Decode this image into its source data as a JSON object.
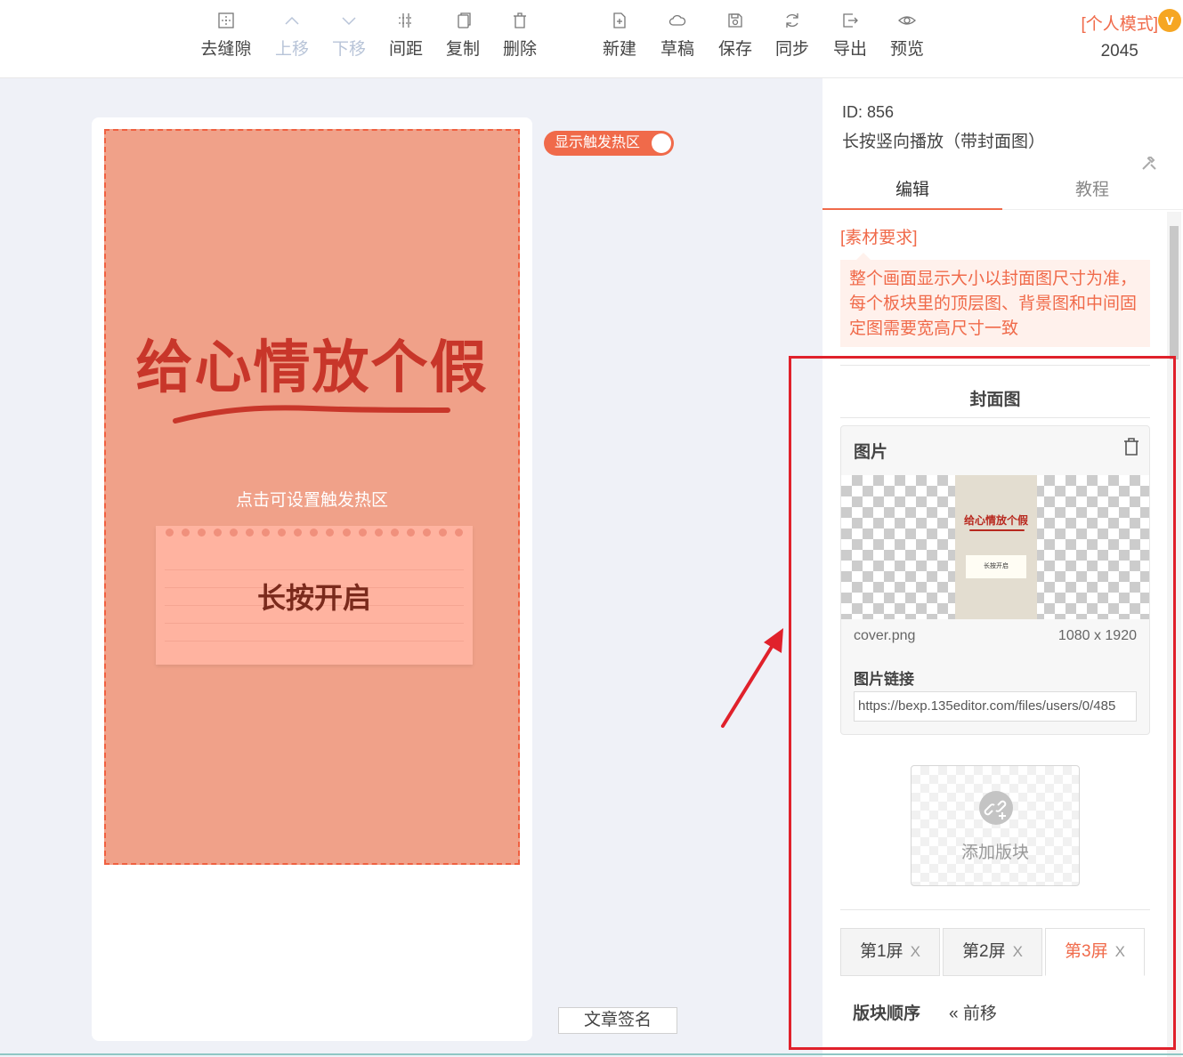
{
  "toolbar": {
    "items": [
      {
        "label": "去缝隙",
        "icon": "gap-icon",
        "disabled": false
      },
      {
        "label": "上移",
        "icon": "chevron-up-icon",
        "disabled": true
      },
      {
        "label": "下移",
        "icon": "chevron-down-icon",
        "disabled": true
      },
      {
        "label": "间距",
        "icon": "spacing-icon",
        "disabled": false
      },
      {
        "label": "复制",
        "icon": "copy-icon",
        "disabled": false
      },
      {
        "label": "删除",
        "icon": "trash-icon",
        "disabled": false
      },
      {
        "label": "新建",
        "icon": "new-file-icon",
        "disabled": false
      },
      {
        "label": "草稿",
        "icon": "cloud-icon",
        "disabled": false
      },
      {
        "label": "保存",
        "icon": "save-icon",
        "disabled": false
      },
      {
        "label": "同步",
        "icon": "sync-icon",
        "disabled": false
      },
      {
        "label": "导出",
        "icon": "export-icon",
        "disabled": false
      },
      {
        "label": "预览",
        "icon": "eye-icon",
        "disabled": false
      }
    ],
    "mode_label": "[个人模式]",
    "vip_badge": "v",
    "user_number": "2045"
  },
  "canvas": {
    "headline": "给心情放个假",
    "hotzone_hint": "点击可设置触发热区",
    "note_text": "长按开启",
    "toggle_label": "显示触发热区",
    "sign_button": "文章签名"
  },
  "panel": {
    "id_text": "ID: 856",
    "template_name": "长按竖向播放（带封面图）",
    "tabs": [
      {
        "label": "编辑",
        "active": true
      },
      {
        "label": "教程",
        "active": false
      }
    ],
    "requirement_title": "[素材要求]",
    "requirement_text": "整个画面显示大小以封面图尺寸为准，每个板块里的顶层图、背景图和中间固定图需要宽高尺寸一致",
    "section_title": "封面图",
    "image_card": {
      "title": "图片",
      "thumb_headline": "给心情放个假",
      "thumb_note": "长按开启",
      "filename": "cover.png",
      "dimensions": "1080 x 1920",
      "link_label": "图片链接",
      "link_value": "https://bexp.135editor.com/files/users/0/485"
    },
    "add_block_label": "添加版块",
    "screens": [
      {
        "label": "第1屏",
        "close": "X",
        "active": false
      },
      {
        "label": "第2屏",
        "close": "X",
        "active": false
      },
      {
        "label": "第3屏",
        "close": "X",
        "active": true
      }
    ],
    "order_label": "版块顺序",
    "move_forward": "« 前移"
  },
  "colors": {
    "accent": "#f06a4a",
    "highlight_red": "#e0212b",
    "cover_bg": "#f0a189",
    "headline_red": "#c8362a"
  }
}
